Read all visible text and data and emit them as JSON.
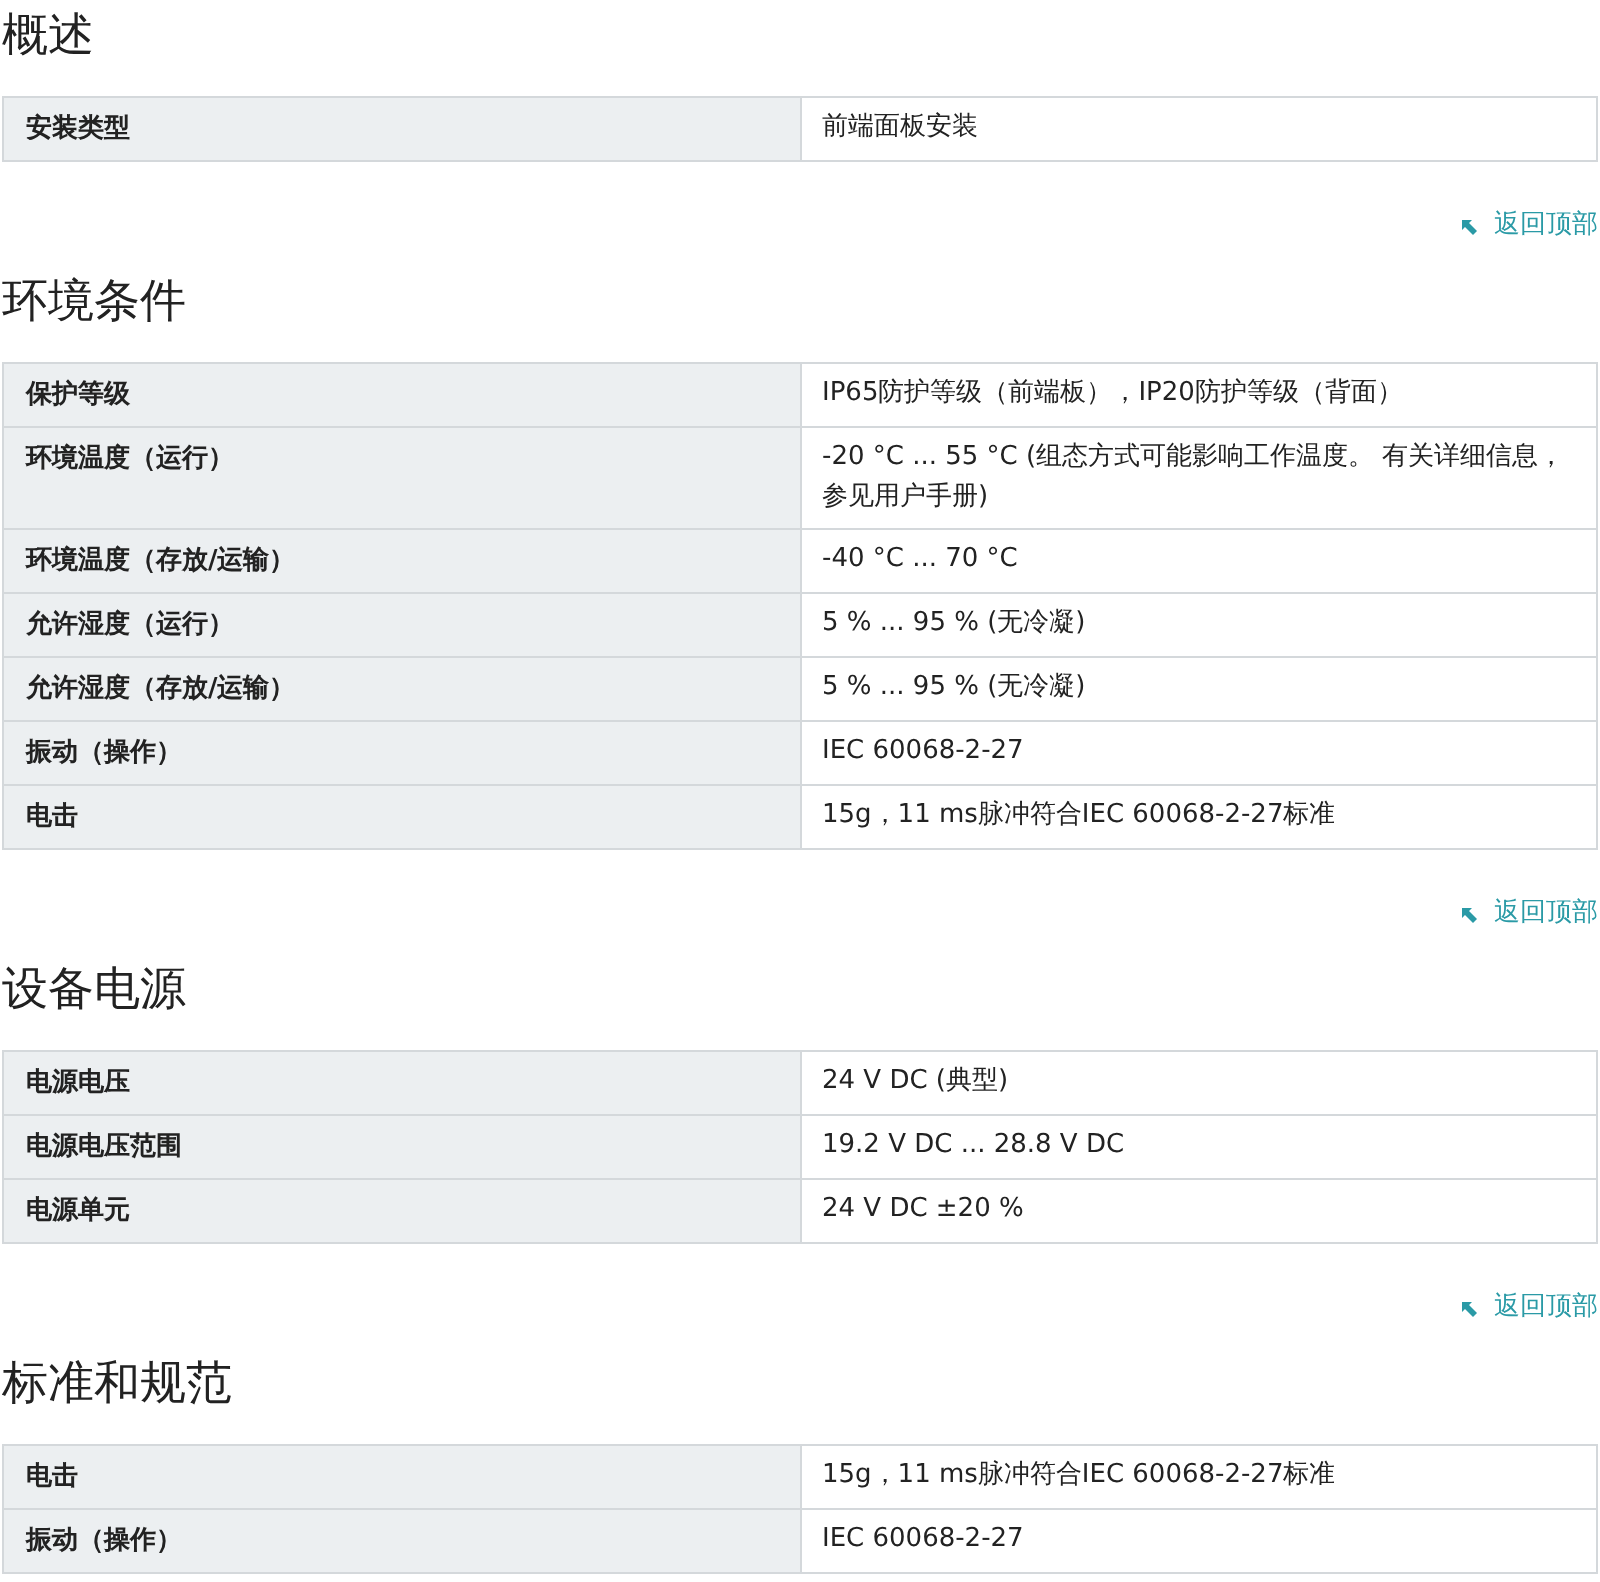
{
  "sections": [
    {
      "title": "概述",
      "rows": [
        {
          "label": "安装类型",
          "value": "前端面板安装"
        }
      ],
      "back_link": "返回顶部"
    },
    {
      "title": "环境条件",
      "rows": [
        {
          "label": "保护等级",
          "value": "IP65防护等级（前端板），IP20防护等级（背面）"
        },
        {
          "label": "环境温度（运行）",
          "value": "-20 °C ... 55 °C (组态方式可能影响工作温度。 有关详细信息，参见用户手册)"
        },
        {
          "label": "环境温度（存放/运输）",
          "value": "-40 °C ... 70 °C"
        },
        {
          "label": "允许湿度（运行）",
          "value": "5 % ... 95 % (无冷凝)"
        },
        {
          "label": "允许湿度（存放/运输）",
          "value": "5 % ... 95 % (无冷凝)"
        },
        {
          "label": "振动（操作）",
          "value": "IEC 60068-2-27"
        },
        {
          "label": "电击",
          "value": "15g，11 ms脉冲符合IEC 60068-2-27标准"
        }
      ],
      "back_link": "返回顶部"
    },
    {
      "title": "设备电源",
      "rows": [
        {
          "label": "电源电压",
          "value": "24 V DC (典型)"
        },
        {
          "label": "电源电压范围",
          "value": "19.2 V DC ... 28.8 V DC"
        },
        {
          "label": "电源单元",
          "value": "24 V DC ±20 %"
        }
      ],
      "back_link": "返回顶部"
    },
    {
      "title": "标准和规范",
      "rows": [
        {
          "label": "电击",
          "value": "15g，11 ms脉冲符合IEC 60068-2-27标准"
        },
        {
          "label": "振动（操作）",
          "value": "IEC 60068-2-27"
        }
      ]
    }
  ]
}
